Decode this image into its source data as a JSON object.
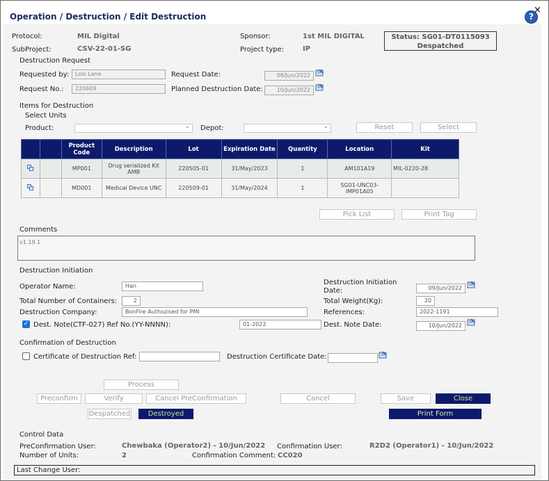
{
  "window": {
    "title": "Operation / Destruction / Edit Destruction",
    "help_glyph": "?",
    "close_glyph": "×"
  },
  "header": {
    "protocol_label": "Protocol:",
    "protocol_value": "MIL Digital",
    "subproject_label": "SubProject:",
    "subproject_value": "CSV-22-01-SG",
    "sponsor_label": "Sponsor:",
    "sponsor_value": "1st MIL DIGITAL",
    "project_type_label": "Project type:",
    "project_type_value": "IP",
    "status_line1": "Status: SG01-DT0115093",
    "status_line2": "Despatched"
  },
  "request": {
    "section_title": "Destruction Request",
    "requested_by_label": "Requested by:",
    "requested_by_value": "Lois Lane",
    "request_date_label": "Request Date:",
    "request_date_value": "08/Jun/2022",
    "request_no_label": "Request No.:",
    "request_no_value": "220609",
    "planned_date_label": "Planned Destruction Date:",
    "planned_date_value": "10/Jun/2022"
  },
  "items": {
    "section_title": "Items for Destruction",
    "select_units_label": "Select Units",
    "product_label": "Product:",
    "product_value": "",
    "depot_label": "Depot:",
    "depot_value": "",
    "reset_label": "Reset",
    "select_label": "Select",
    "columns": [
      "",
      "",
      "Product Code",
      "Description",
      "Lot",
      "Expiration Date",
      "Quantity",
      "Location",
      "Kit"
    ],
    "rows": [
      {
        "code": "MP001",
        "description": "Drug serialized Kit AMB",
        "lot": "220505-01",
        "expiration": "31/May/2023",
        "quantity": "1",
        "location": "AM101A19",
        "kit": "MIL-0220-28"
      },
      {
        "code": "MD001",
        "description": "Medical Device UNC",
        "lot": "220509-01",
        "expiration": "31/May/2024",
        "quantity": "1",
        "location": "SG01-UNC03-IMP01A05",
        "kit": ""
      }
    ],
    "pick_list_label": "Pick List",
    "print_tag_label": "Print Tag"
  },
  "comments": {
    "label": "Comments",
    "value": "v1.19.1"
  },
  "initiation": {
    "section_title": "Destruction Initiation",
    "operator_label": "Operator Name:",
    "operator_value": "Han",
    "init_date_label_1": "Destruction Initiation",
    "init_date_label_2": "Date:",
    "init_date_value": "09/Jun/2022",
    "containers_label": "Total Number of Containers:",
    "containers_value": "2",
    "weight_label": "Total Weight(Kg):",
    "weight_value": "20",
    "company_label": "Destruction Company:",
    "company_value": "BonFire Authozised for PMI",
    "references_label": "References:",
    "references_value": "2022-1191",
    "note_label": "Dest. Note(CTF-027) Ref No.(YY-NNNN):",
    "note_value": "01-2022",
    "note_date_label": "Dest. Note Date:",
    "note_date_value": "10/Jun/2022"
  },
  "confirmation": {
    "section_title": "Confirmation of Destruction",
    "cert_ref_label": "Certificate of Destruction Ref:",
    "cert_ref_value": "",
    "cert_date_label": "Destruction Certificate Date:",
    "cert_date_value": ""
  },
  "actions": {
    "process": "Process",
    "preconfirm": "Preconfirm",
    "verify": "Verify",
    "cancel_preconfirmation": "Cancel PreConfirmation",
    "cancel": "Cancel",
    "save": "Save",
    "close": "Close",
    "despatched": "Despatched",
    "destroyed": "Destroyed",
    "print_form": "Print Form"
  },
  "control": {
    "section_title": "Control Data",
    "preconf_user_label": "PreConfirmation User:",
    "preconf_user_value": "Chewbaka (Operator2) - 10/Jun/2022",
    "conf_user_label": "Confirmation User:",
    "conf_user_value": "R2D2 (Operator1) - 10/Jun/2022",
    "units_label": "Number of Units:",
    "units_value": "2",
    "conf_comment_label": "Confirmation Comment:",
    "conf_comment_value": "CC020",
    "last_change_label": "Last Change User:"
  },
  "colors": {
    "header_navy": "#0d1a6b",
    "accent_green": "#bfe98f",
    "title_blue": "#1a2c5c"
  }
}
